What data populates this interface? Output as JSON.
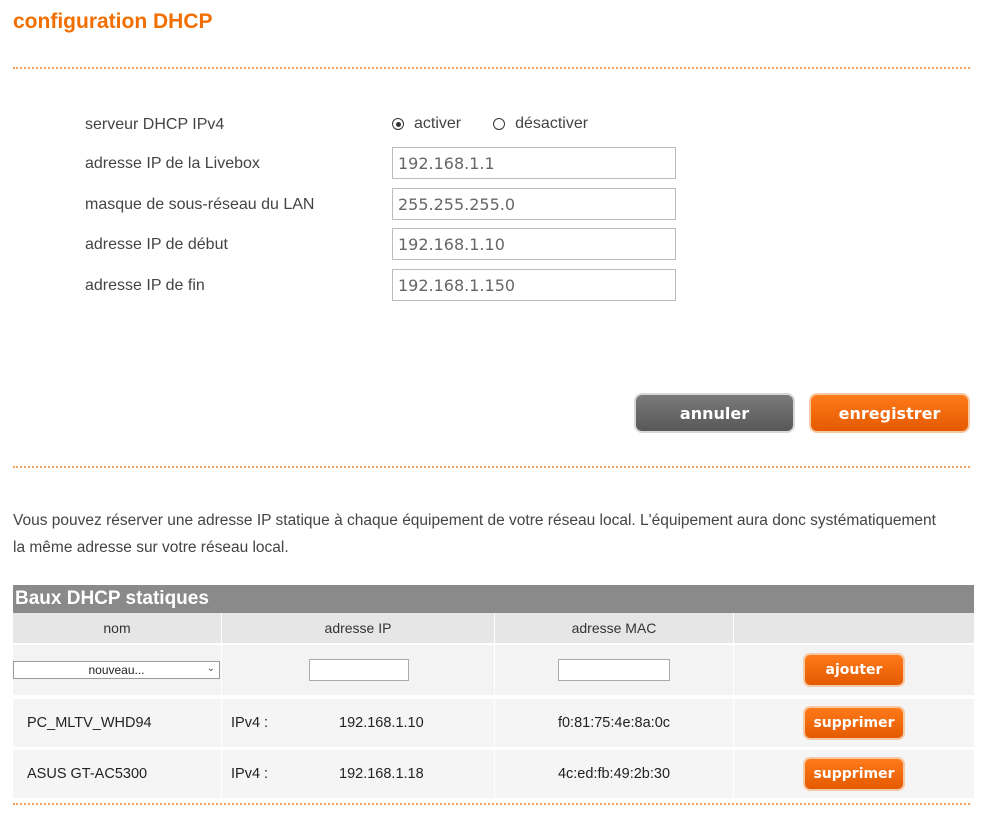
{
  "page": {
    "title": "configuration DHCP"
  },
  "dhcp_form": {
    "server_label": "serveur DHCP IPv4",
    "enable_label": "activer",
    "disable_label": "désactiver",
    "server_enabled": true,
    "livebox_ip_label": "adresse IP de la Livebox",
    "livebox_ip_value": "192.168.1.1",
    "subnet_mask_label": "masque de sous-réseau du LAN",
    "subnet_mask_value": "255.255.255.0",
    "start_ip_label": "adresse IP de début",
    "start_ip_value": "192.168.1.10",
    "end_ip_label": "adresse IP de fin",
    "end_ip_value": "192.168.1.150"
  },
  "actions": {
    "cancel_label": "annuler",
    "save_label": "enregistrer"
  },
  "info_text": "Vous pouvez réserver une adresse IP statique à chaque équipement de votre réseau local. L'équipement aura donc systématiquement la même adresse sur votre réseau local.",
  "static_leases": {
    "title": "Baux DHCP statiques",
    "columns": [
      "nom",
      "adresse IP",
      "adresse MAC",
      ""
    ],
    "new_row": {
      "select_value": "nouveau...",
      "add_label": "ajouter"
    },
    "ipv4_prefix": "IPv4 :",
    "delete_label": "supprimer",
    "rows": [
      {
        "name": "PC_MLTV_WHD94",
        "ip": "192.168.1.10",
        "mac": "f0:81:75:4e:8a:0c"
      },
      {
        "name": "ASUS GT-AC5300",
        "ip": "192.168.1.18",
        "mac": "4c:ed:fb:49:2b:30"
      }
    ]
  },
  "colors": {
    "accent": "#f16e00",
    "button_grey": "#666666",
    "table_header": "#8a8a8a"
  }
}
